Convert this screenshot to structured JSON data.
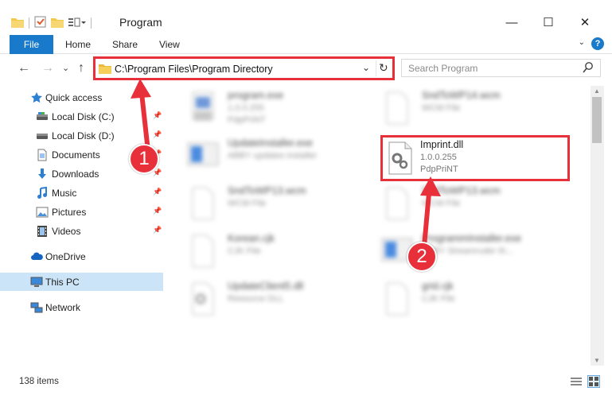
{
  "window": {
    "title": "Program",
    "minimize": "—",
    "maximize": "☐",
    "close": "✕"
  },
  "ribbon": {
    "tabs": [
      "File",
      "Home",
      "Share",
      "View"
    ],
    "help": "?",
    "collapse": "⌄"
  },
  "nav": {
    "back": "←",
    "forward": "→",
    "recent": "⌄",
    "up": "↑",
    "address": "C:\\Program Files\\Program Directory",
    "dropdown": "⌄",
    "refresh": "↻",
    "search_placeholder": "Search Program"
  },
  "sidebar": {
    "items": [
      {
        "label": "Quick access",
        "icon": "star-icon"
      },
      {
        "label": "Local Disk (C:)",
        "icon": "drive-icon"
      },
      {
        "label": "Local Disk (D:)",
        "icon": "drive-icon"
      },
      {
        "label": "Documents",
        "icon": "documents-icon"
      },
      {
        "label": "Downloads",
        "icon": "download-icon"
      },
      {
        "label": "Music",
        "icon": "music-icon"
      },
      {
        "label": "Pictures",
        "icon": "pictures-icon"
      },
      {
        "label": "Videos",
        "icon": "videos-icon"
      },
      {
        "label": "OneDrive",
        "icon": "cloud-icon"
      },
      {
        "label": "This PC",
        "icon": "computer-icon"
      },
      {
        "label": "Network",
        "icon": "network-icon"
      }
    ]
  },
  "files": [
    {
      "name": "program.exe",
      "line2": "1.0.0.255",
      "line3": "PdpPriNT"
    },
    {
      "name": "SndToWP14.wcm",
      "line2": "WCM File",
      "line3": ""
    },
    {
      "name": "UpdateInstaller.exe",
      "line2": "ABBY updates installer",
      "line3": ""
    },
    {
      "name": "Imprint.dll",
      "line2": "1.0.0.255",
      "line3": "PdpPriNT"
    },
    {
      "name": "SndToWP13.wcm",
      "line2": "WCM File",
      "line3": ""
    },
    {
      "name": "SndToWP13.wcm",
      "line2": "WCM File",
      "line3": ""
    },
    {
      "name": "Korean.cjk",
      "line2": "CJK File",
      "line3": ""
    },
    {
      "name": "ProgrammInstaller.exe",
      "line2": "ABBY Streamruder th...",
      "line3": ""
    },
    {
      "name": "UpdateClient5.dll",
      "line2": "Resource DLL",
      "line3": ""
    },
    {
      "name": "grid.cjk",
      "line2": "CJK File",
      "line3": ""
    }
  ],
  "status": {
    "item_count": "138 items"
  },
  "callouts": [
    "1",
    "2"
  ],
  "colors": {
    "accent": "#1979ca",
    "highlight": "#e8303b",
    "selected": "#cce4f7"
  }
}
